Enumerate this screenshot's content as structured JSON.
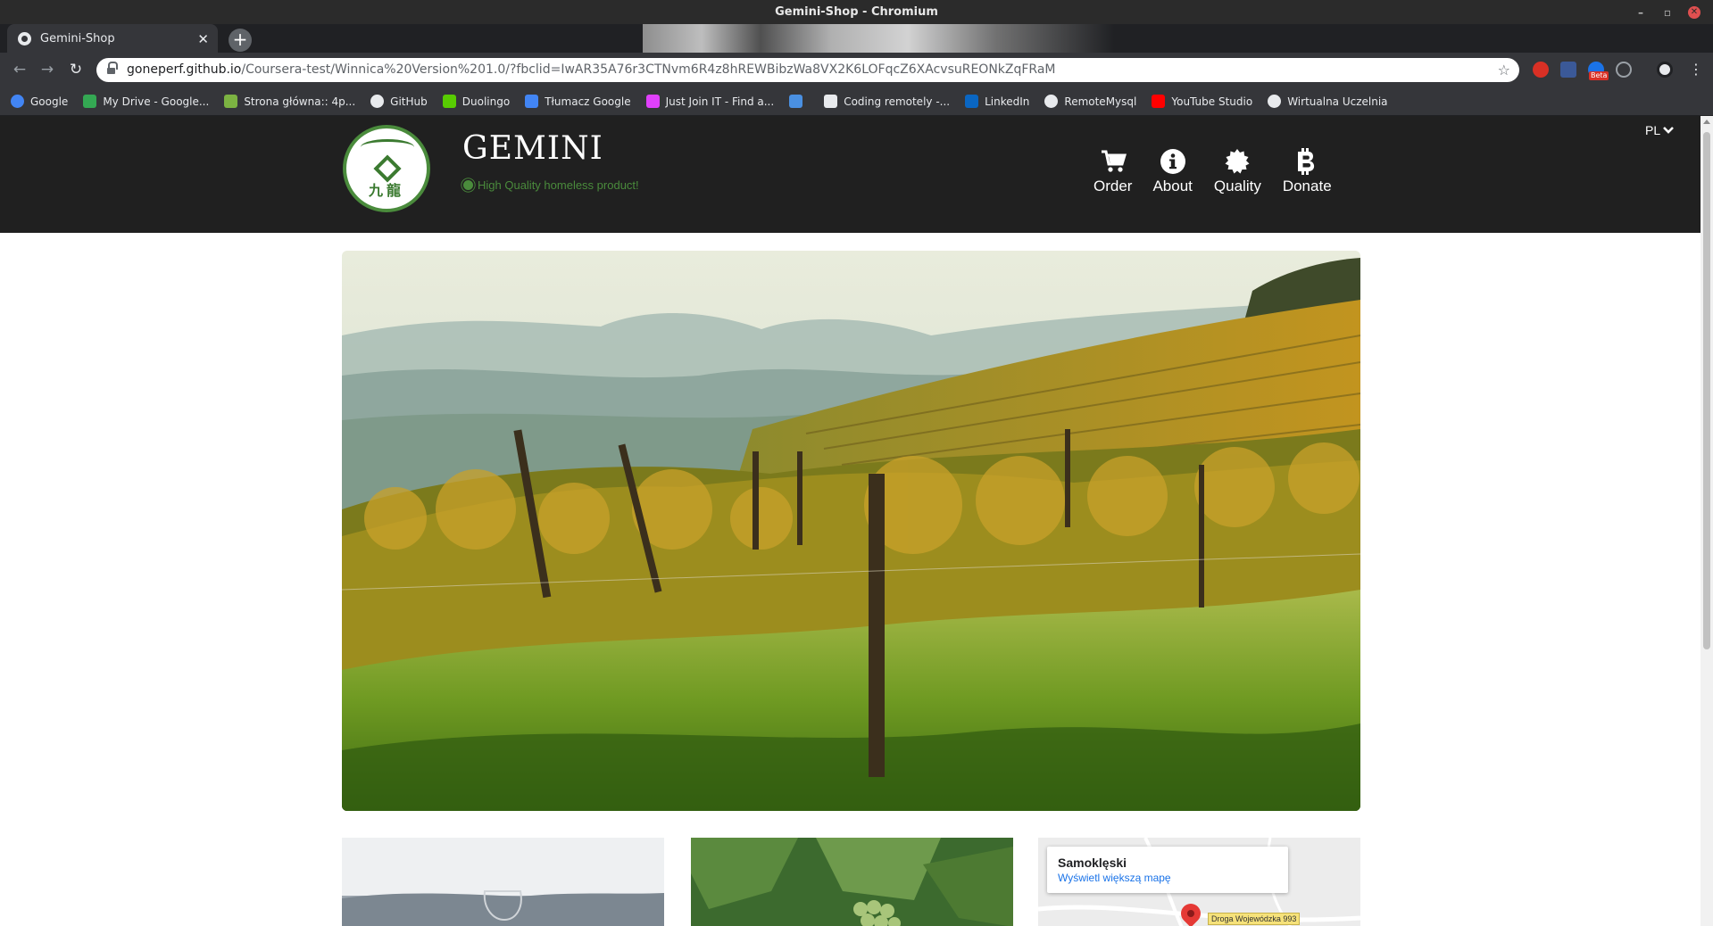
{
  "window": {
    "title": "Gemini-Shop - Chromium"
  },
  "tab": {
    "title": "Gemini-Shop"
  },
  "address": {
    "host": "goneperf.github.io",
    "path": "/Coursera-test/Winnica%20Version%201.0/?fbclid=IwAR35A76r3CTNvm6R4z8hREWBibzWa8VX2K6LOFqcZ6XAcvsuREONkZqFRaM"
  },
  "extensions": {
    "badge": "Beta"
  },
  "bookmarks": [
    {
      "label": "Google",
      "icon": "google-icon",
      "color": "#4285f4"
    },
    {
      "label": "My Drive - Google...",
      "icon": "drive-icon",
      "color": "#34a853"
    },
    {
      "label": "Strona główna:: 4p...",
      "icon": "site-icon",
      "color": "#7cb342"
    },
    {
      "label": "GitHub",
      "icon": "github-icon",
      "color": "#e8eaed"
    },
    {
      "label": "Duolingo",
      "icon": "duolingo-icon",
      "color": "#58cc02"
    },
    {
      "label": "Tłumacz Google",
      "icon": "translate-icon",
      "color": "#4285f4"
    },
    {
      "label": "Just Join IT - Find a...",
      "icon": "justjoin-icon",
      "color": "#e040fb"
    },
    {
      "label": "",
      "icon": "bird-icon",
      "color": "#4a90e2"
    },
    {
      "label": "Coding remotely -...",
      "icon": "remote-icon",
      "color": "#e8eaed"
    },
    {
      "label": "LinkedIn",
      "icon": "linkedin-icon",
      "color": "#0a66c2"
    },
    {
      "label": "RemoteMysql",
      "icon": "globe-icon",
      "color": "#e8eaed"
    },
    {
      "label": "YouTube Studio",
      "icon": "youtube-icon",
      "color": "#ff0000"
    },
    {
      "label": "Wirtualna Uczelnia",
      "icon": "globe-icon",
      "color": "#e8eaed"
    }
  ],
  "site": {
    "brand": "GEMINI",
    "tagline": "High Quality homeless product!",
    "logo_text": "九龍",
    "accent": "#4a8b3c",
    "nav": [
      {
        "label": "Order",
        "icon": "cart-icon"
      },
      {
        "label": "About",
        "icon": "info-icon"
      },
      {
        "label": "Quality",
        "icon": "certificate-icon"
      },
      {
        "label": "Donate",
        "icon": "bitcoin-icon"
      }
    ],
    "language": "PL"
  },
  "map": {
    "place": "Samoklęski",
    "link": "Wyświetl większą mapę",
    "road": "Droga Wojewódzka 993"
  }
}
